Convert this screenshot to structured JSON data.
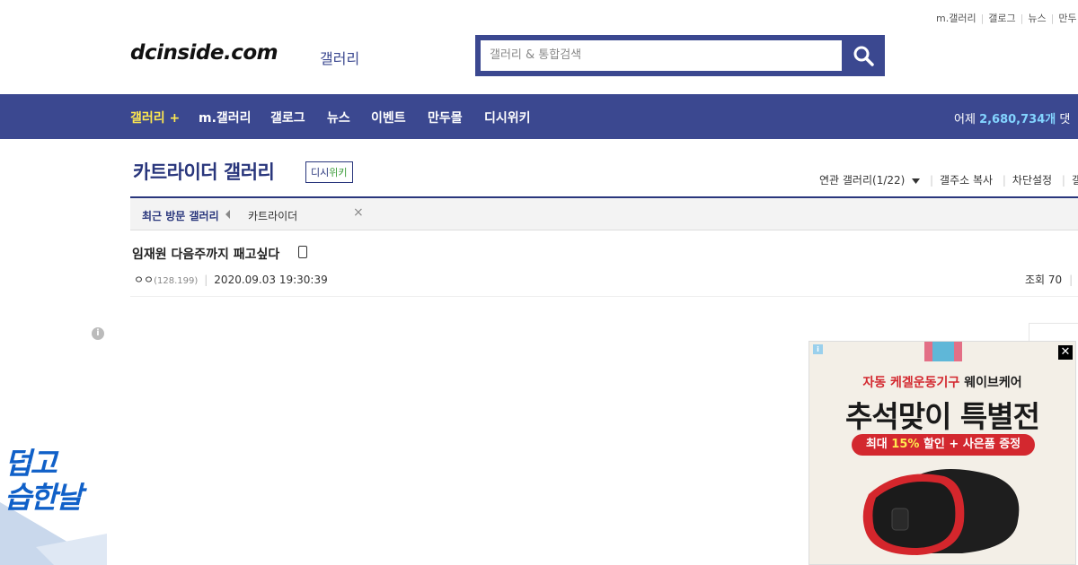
{
  "top_links": [
    "m.갤러리",
    "갤로그",
    "뉴스",
    "만두"
  ],
  "logo": {
    "main": "dcinside.com",
    "sub": "갤러리"
  },
  "search": {
    "placeholder": "갤러리 & 통합검색"
  },
  "gnb": {
    "items": [
      "갤러리 +",
      "m.갤러리",
      "갤로그",
      "뉴스",
      "이벤트",
      "만두몰",
      "디시위키"
    ],
    "stat_label": "어제",
    "stat_value": "2,680,734개",
    "stat_tail": "댓"
  },
  "gallery": {
    "title": "카트라이더 갤러리",
    "badge_a": "디시",
    "badge_b": "위키",
    "options": [
      "연관 갤러리(1/22)",
      "갤주소 복사",
      "차단설정",
      "갤"
    ]
  },
  "recent": {
    "label": "최근 방문 갤러리",
    "item": "카트라이더",
    "close": "×"
  },
  "post": {
    "title": "임재원 다음주까지 패고싶다",
    "author": "ㅇㅇ",
    "ip": "(128.199)",
    "date": "2020.09.03 19:30:39",
    "views": "조회 70"
  },
  "left_banner": {
    "line1": "덥고",
    "line2": "습한날"
  },
  "ad": {
    "line1_red": "자동 케겔운동기구",
    "line1_black": "웨이브케어",
    "line2": "추석맞이 특별전",
    "pill_a": "최대",
    "pill_b": "15%",
    "pill_c": "할인 + 사은품 증정",
    "info": "i",
    "close": "✕"
  },
  "colors": {
    "brand": "#3b4890",
    "title_blue": "#29367c",
    "active_yellow": "#ffe94f",
    "ad_red": "#d3282f"
  }
}
